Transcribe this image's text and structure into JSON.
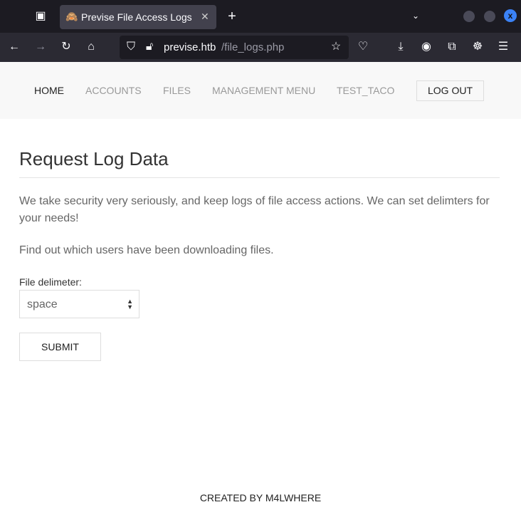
{
  "browser": {
    "tab_title": "Previse File Access Logs",
    "url_host": "previse.htb",
    "url_path": "/file_logs.php"
  },
  "nav": {
    "items": [
      "HOME",
      "ACCOUNTS",
      "FILES",
      "MANAGEMENT MENU",
      "TEST_TACO"
    ],
    "logout": "LOG OUT"
  },
  "main": {
    "title": "Request Log Data",
    "para1": "We take security very seriously, and keep logs of file access actions. We can set delimters for your needs!",
    "para2": "Find out which users have been downloading files.",
    "delimiter_label": "File delimeter:",
    "delimiter_value": "space",
    "submit": "SUBMIT"
  },
  "footer": "CREATED BY M4LWHERE"
}
